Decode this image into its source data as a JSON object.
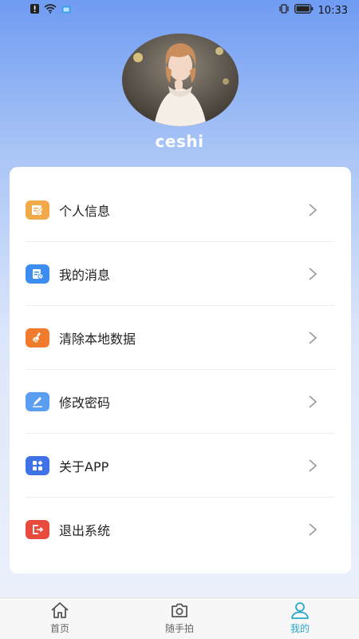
{
  "status_bar": {
    "time": "10:33",
    "left_icons": [
      "alert-icon",
      "wifi-icon",
      "screen-icon"
    ],
    "right_icons": [
      "vibrate-icon",
      "battery-icon"
    ]
  },
  "profile": {
    "username": "ceshi"
  },
  "menu": [
    {
      "label": "个人信息",
      "icon": "id-card-icon",
      "color": "#f2a94a"
    },
    {
      "label": "我的消息",
      "icon": "message-icon",
      "color": "#3d8df0"
    },
    {
      "label": "清除本地数据",
      "icon": "broom-icon",
      "color": "#f07b2c"
    },
    {
      "label": "修改密码",
      "icon": "pencil-icon",
      "color": "#5a9ef2"
    },
    {
      "label": "关于APP",
      "icon": "apps-icon",
      "color": "#3f72e6"
    },
    {
      "label": "退出系统",
      "icon": "exit-icon",
      "color": "#e84b3d"
    }
  ],
  "tabbar": {
    "tabs": [
      {
        "label": "首页",
        "icon": "home-icon"
      },
      {
        "label": "随手拍",
        "icon": "camera-icon"
      },
      {
        "label": "我的",
        "icon": "user-icon"
      }
    ],
    "active_color": "#28a8c8"
  }
}
